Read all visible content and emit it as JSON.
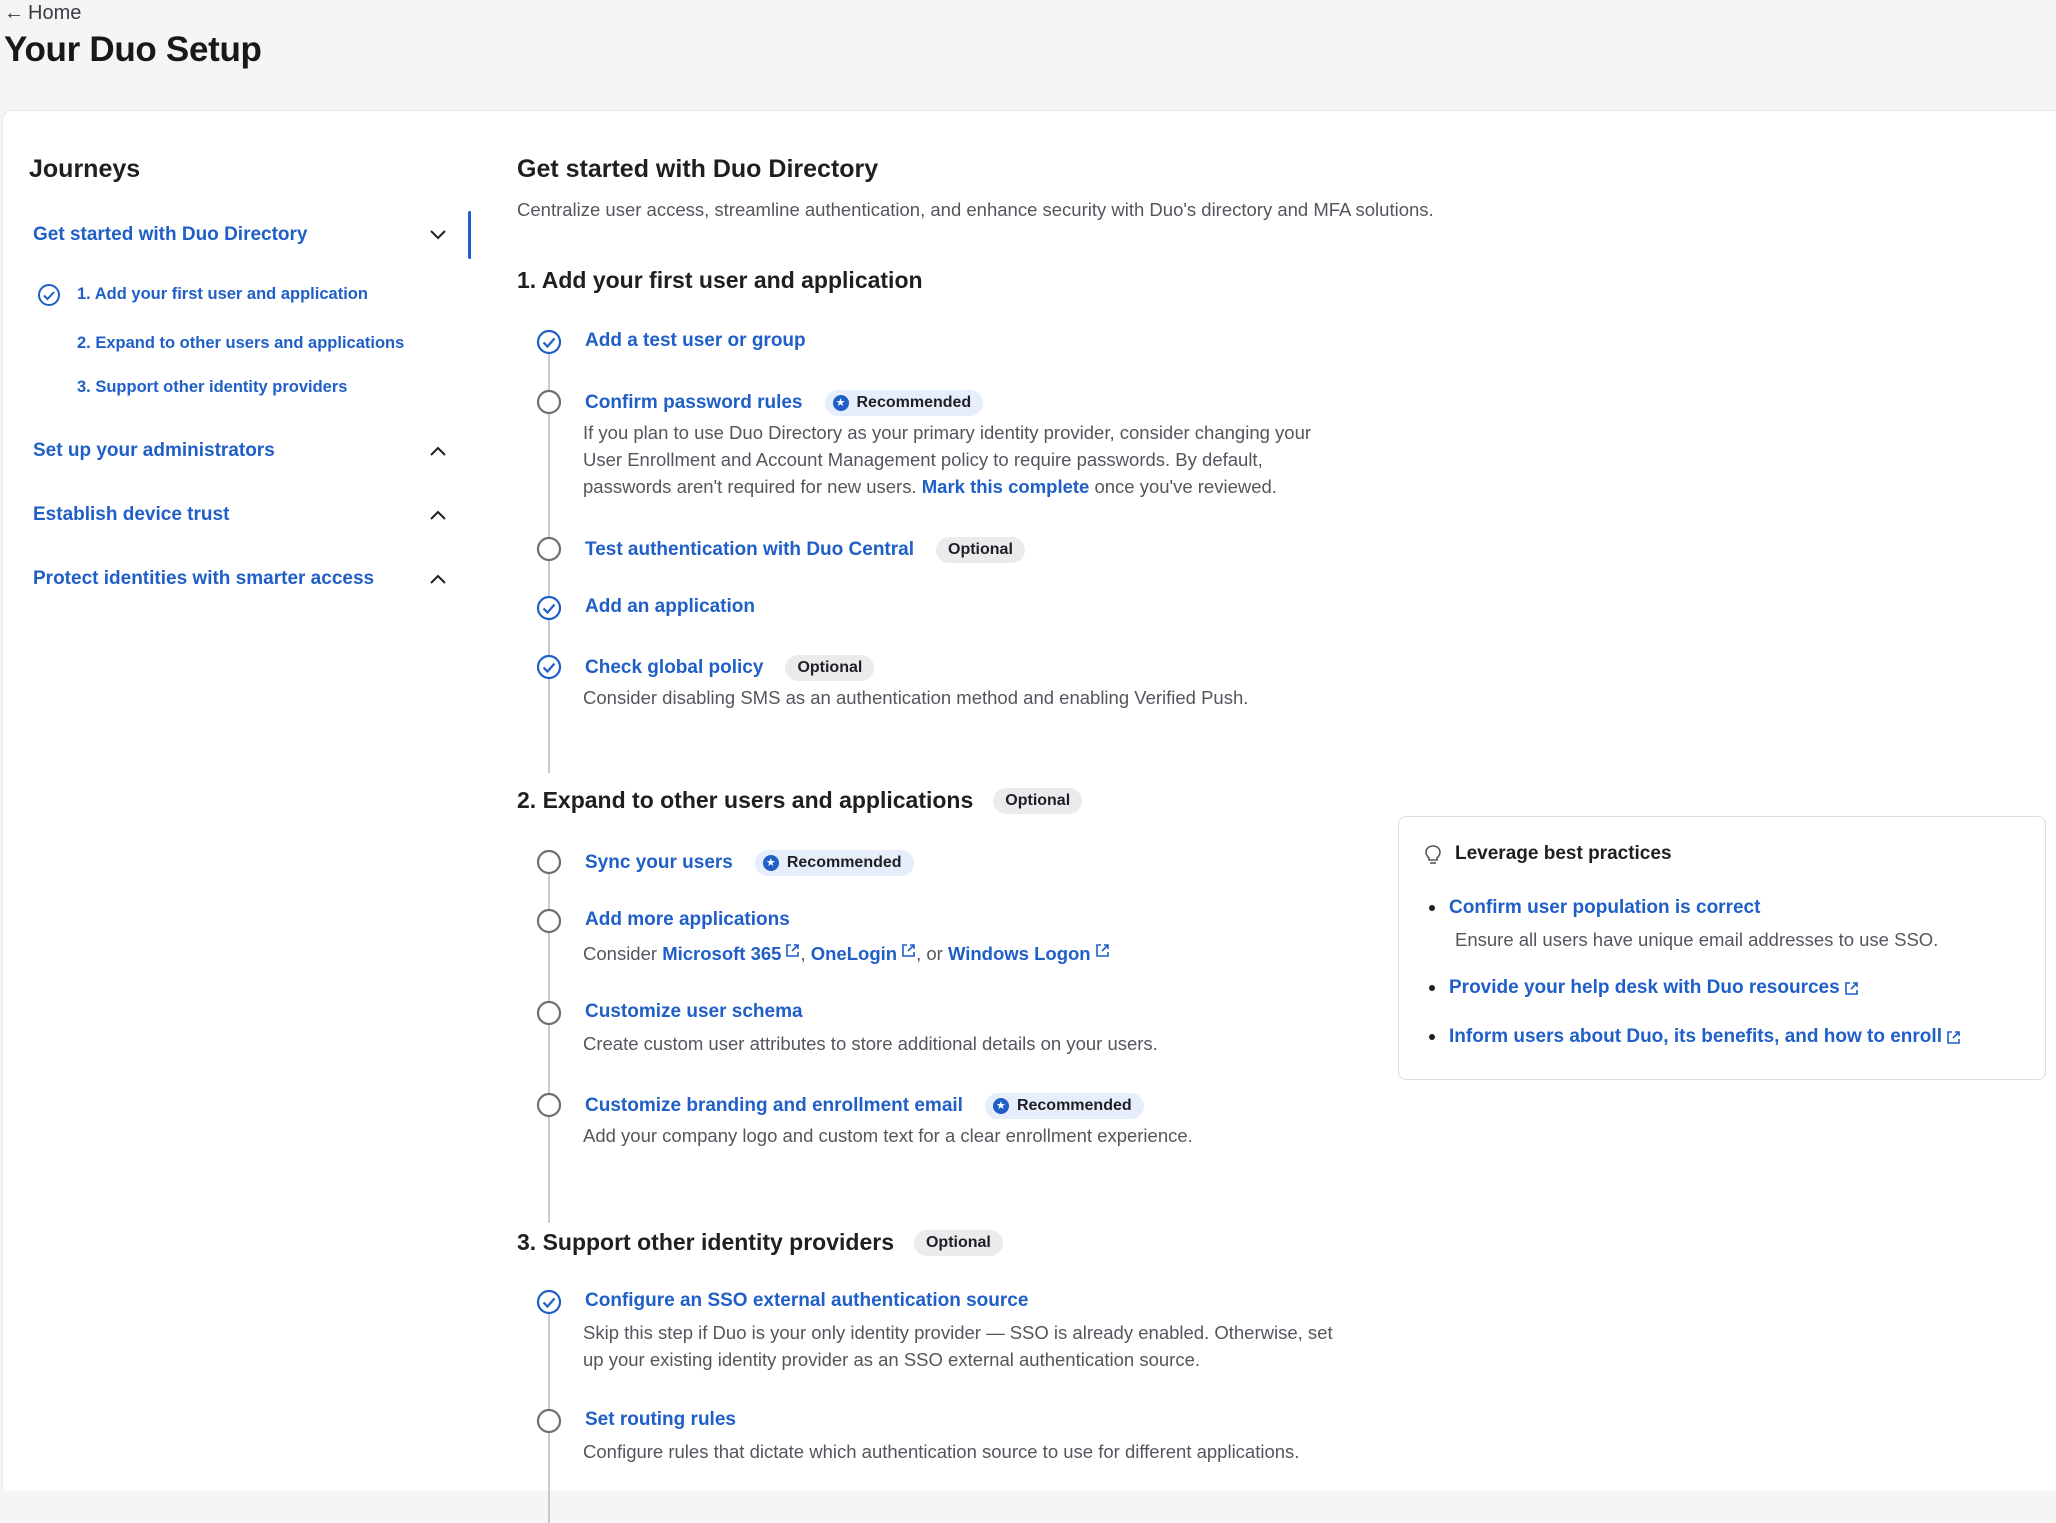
{
  "header": {
    "back_label": "Home",
    "title": "Your Duo Setup"
  },
  "sidebar": {
    "title": "Journeys",
    "journeys": [
      {
        "label": "Get started with Duo Directory",
        "expanded": true
      },
      {
        "label": "Set up your administrators",
        "expanded": false
      },
      {
        "label": "Establish device trust",
        "expanded": false
      },
      {
        "label": "Protect identities with smarter access",
        "expanded": false
      }
    ],
    "subitems": [
      {
        "label": "1. Add your first user and application",
        "complete": true
      },
      {
        "label": "2. Expand to other users and applications",
        "complete": false
      },
      {
        "label": "3. Support other identity providers",
        "complete": false
      }
    ]
  },
  "main": {
    "title": "Get started with Duo Directory",
    "lead": "Centralize user access, streamline authentication, and enhance security with Duo's directory and MFA solutions.",
    "sections": [
      {
        "title": "1. Add your first user and application",
        "steps": [
          {
            "title": "Add a test user or group",
            "complete": true
          },
          {
            "title": "Confirm password rules",
            "badge": "Recommended",
            "complete": false,
            "desc_1": "If you plan to use Duo Directory as your primary identity provider, consider changing your",
            "desc_2": "User Enrollment and Account Management policy to require passwords. By default,",
            "desc_3_pre": "passwords aren't required for new users. ",
            "desc_3_link": "Mark this complete",
            "desc_3_post": " once you've reviewed."
          },
          {
            "title": "Test authentication with Duo Central",
            "badge": "Optional",
            "complete": false
          },
          {
            "title": "Add an application",
            "complete": true
          },
          {
            "title": "Check global policy",
            "badge": "Optional",
            "complete": true,
            "desc": "Consider disabling SMS as an authentication method and enabling Verified Push."
          }
        ]
      },
      {
        "title": "2. Expand to other users and applications",
        "badge": "Optional",
        "steps": [
          {
            "title": "Sync your users",
            "badge": "Recommended",
            "complete": false
          },
          {
            "title": "Add more applications",
            "complete": false,
            "desc_pre": "Consider ",
            "link_1": "Microsoft 365",
            "sep_1": ", ",
            "link_2": "OneLogin",
            "sep_2": ", or ",
            "link_3": "Windows Logon"
          },
          {
            "title": "Customize user schema",
            "complete": false,
            "desc": "Create custom user attributes to store additional details on your users."
          },
          {
            "title": "Customize branding and enrollment email",
            "badge": "Recommended",
            "complete": false,
            "desc": "Add your company logo and custom text for a clear enrollment experience."
          }
        ]
      },
      {
        "title": "3. Support other identity providers",
        "badge": "Optional",
        "steps": [
          {
            "title": "Configure an SSO external authentication source",
            "complete": true,
            "desc_1": "Skip this step if Duo is your only identity provider — SSO is already enabled. Otherwise, set",
            "desc_2": "up your existing identity provider as an SSO external authentication source."
          },
          {
            "title": "Set routing rules",
            "complete": false,
            "desc": "Configure rules that dictate which authentication source to use for different applications."
          }
        ]
      }
    ]
  },
  "best_practices": {
    "title": "Leverage best practices",
    "items": [
      {
        "label": "Confirm user population is correct",
        "desc": "Ensure all users have unique email addresses to use SSO."
      },
      {
        "label": "Provide your help desk with Duo resources"
      },
      {
        "label": "Inform users about Duo, its benefits, and how to enroll"
      }
    ]
  },
  "colors": {
    "accent": "#1f5fc7",
    "page_bg": "#f5f5f6",
    "badge_optional_bg": "#ebebee",
    "badge_recommended_bg": "#e6eefb"
  }
}
